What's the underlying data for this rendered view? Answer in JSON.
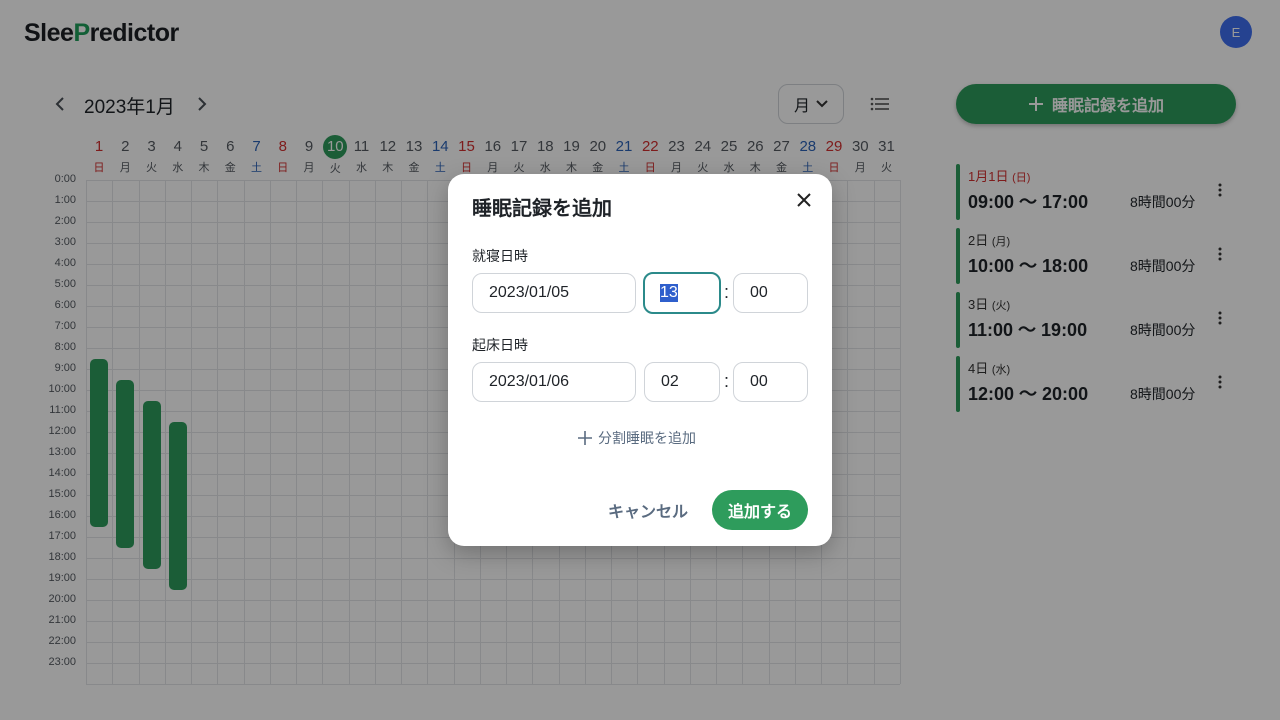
{
  "header": {
    "logo_left": "Slee",
    "logo_p": "P",
    "logo_right": "redictor",
    "avatar_initial": "E"
  },
  "calendar": {
    "month_title": "2023年1月",
    "view_select": "月",
    "days": [
      {
        "n": "1",
        "w": "日",
        "t": "sun"
      },
      {
        "n": "2",
        "w": "月",
        "t": ""
      },
      {
        "n": "3",
        "w": "火",
        "t": ""
      },
      {
        "n": "4",
        "w": "水",
        "t": ""
      },
      {
        "n": "5",
        "w": "木",
        "t": ""
      },
      {
        "n": "6",
        "w": "金",
        "t": ""
      },
      {
        "n": "7",
        "w": "土",
        "t": "sat"
      },
      {
        "n": "8",
        "w": "日",
        "t": "sun"
      },
      {
        "n": "9",
        "w": "月",
        "t": ""
      },
      {
        "n": "10",
        "w": "火",
        "t": "today"
      },
      {
        "n": "11",
        "w": "水",
        "t": ""
      },
      {
        "n": "12",
        "w": "木",
        "t": ""
      },
      {
        "n": "13",
        "w": "金",
        "t": ""
      },
      {
        "n": "14",
        "w": "土",
        "t": "sat"
      },
      {
        "n": "15",
        "w": "日",
        "t": "sun"
      },
      {
        "n": "16",
        "w": "月",
        "t": ""
      },
      {
        "n": "17",
        "w": "火",
        "t": ""
      },
      {
        "n": "18",
        "w": "水",
        "t": ""
      },
      {
        "n": "19",
        "w": "木",
        "t": ""
      },
      {
        "n": "20",
        "w": "金",
        "t": ""
      },
      {
        "n": "21",
        "w": "土",
        "t": "sat"
      },
      {
        "n": "22",
        "w": "日",
        "t": "sun"
      },
      {
        "n": "23",
        "w": "月",
        "t": ""
      },
      {
        "n": "24",
        "w": "火",
        "t": ""
      },
      {
        "n": "25",
        "w": "水",
        "t": ""
      },
      {
        "n": "26",
        "w": "木",
        "t": ""
      },
      {
        "n": "27",
        "w": "金",
        "t": ""
      },
      {
        "n": "28",
        "w": "土",
        "t": "sat"
      },
      {
        "n": "29",
        "w": "日",
        "t": "sun"
      },
      {
        "n": "30",
        "w": "月",
        "t": ""
      },
      {
        "n": "31",
        "w": "火",
        "t": ""
      }
    ],
    "hours": [
      "0:00",
      "1:00",
      "2:00",
      "3:00",
      "4:00",
      "5:00",
      "6:00",
      "7:00",
      "8:00",
      "9:00",
      "10:00",
      "11:00",
      "12:00",
      "13:00",
      "14:00",
      "15:00",
      "16:00",
      "17:00",
      "18:00",
      "19:00",
      "20:00",
      "21:00",
      "22:00",
      "23:00"
    ],
    "sleep_bars": [
      {
        "day": 1,
        "start": 9,
        "end": 17
      },
      {
        "day": 2,
        "start": 10,
        "end": 18
      },
      {
        "day": 3,
        "start": 11,
        "end": 19
      },
      {
        "day": 4,
        "start": 12,
        "end": 20
      }
    ]
  },
  "sidebar": {
    "add_button": "睡眠記録を追加",
    "records": [
      {
        "date": "1月1日",
        "weekday": "(日)",
        "sun": true,
        "time": "09:00 〜 17:00",
        "duration": "8時間00分"
      },
      {
        "date": "2日",
        "weekday": "(月)",
        "sun": false,
        "time": "10:00 〜 18:00",
        "duration": "8時間00分"
      },
      {
        "date": "3日",
        "weekday": "(火)",
        "sun": false,
        "time": "11:00 〜 19:00",
        "duration": "8時間00分"
      },
      {
        "date": "4日",
        "weekday": "(水)",
        "sun": false,
        "time": "12:00 〜 20:00",
        "duration": "8時間00分"
      }
    ]
  },
  "dialog": {
    "title": "睡眠記録を追加",
    "bedtime_label": "就寝日時",
    "bedtime_date": "2023/01/05",
    "bedtime_hour": "13",
    "bedtime_minute": "00",
    "wake_label": "起床日時",
    "wake_date": "2023/01/06",
    "wake_hour": "02",
    "wake_minute": "00",
    "colon": ":",
    "split_link": "分割睡眠を追加",
    "cancel": "キャンセル",
    "submit": "追加する"
  }
}
